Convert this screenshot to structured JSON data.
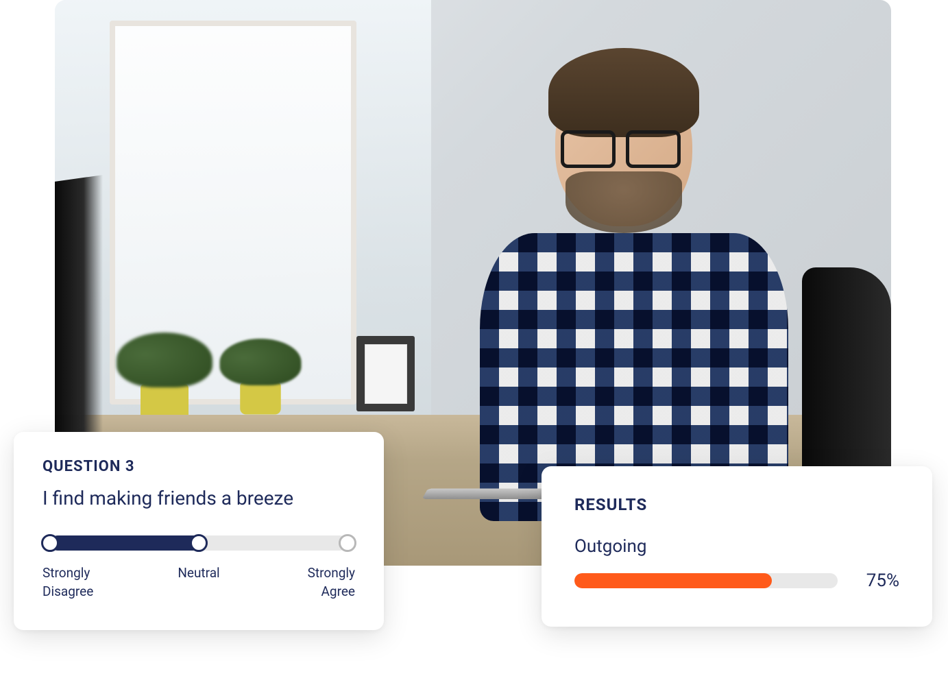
{
  "question_card": {
    "label": "QUESTION 3",
    "text": "I find making friends a breeze",
    "slider": {
      "value_percent": 50,
      "label_min": "Strongly\nDisagree",
      "label_mid": "Neutral",
      "label_max": "Strongly\nAgree"
    }
  },
  "results_card": {
    "title": "RESULTS",
    "trait_label": "Outgoing",
    "trait_percent": 75,
    "trait_percent_text": "75%"
  },
  "colors": {
    "navy": "#1e2a5a",
    "orange": "#ff5a1a",
    "rail": "#e8e8e8"
  }
}
